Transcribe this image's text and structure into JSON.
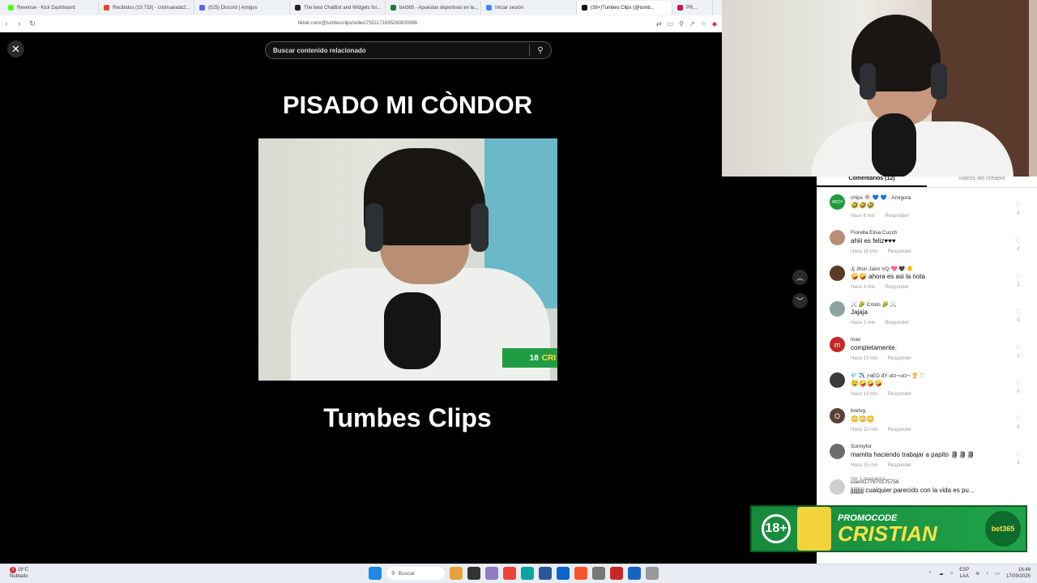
{
  "browser": {
    "tabs": [
      {
        "title": "Revenue - Kick Dashboard",
        "color": "#53fc18"
      },
      {
        "title": "Recibidos (19.733) - crishuarado2...",
        "color": "#ea4335"
      },
      {
        "title": "(525) Discord | Amigos",
        "color": "#5865f2"
      },
      {
        "title": "The best ChatBot and Widgets for...",
        "color": "#222222"
      },
      {
        "title": "bet365 - Apuestas deportivas en la...",
        "color": "#1f7a3d"
      },
      {
        "title": "Iniciar sesión",
        "color": "#4285f4"
      },
      {
        "title": "(39+)Tumbes Clips (@tumb...",
        "color": "#111111"
      },
      {
        "title": "PR...",
        "color": "#c2185b"
      }
    ],
    "url": "tiktok.com/@tumbesclips/video/7551171695260830998"
  },
  "video": {
    "close_icon": "✕",
    "search_placeholder": "Buscar contenido relacionado",
    "title": "PISADO MI CÒNDOR",
    "channel": "Tumbes Clips",
    "badge_text": "CRI",
    "badge_age": "18"
  },
  "comments": {
    "tab_comments": "Comentarios (12)",
    "tab_creator": "Videos del creador",
    "items": [
      {
        "user": "chips 🍭 💙 💙 · Amigo/a",
        "text": "🤣🤣🤣",
        "time": "Hace 6 min",
        "reply": "Responder",
        "likes": "0",
        "avatar": "MICH",
        "avatar_color": "#1e9b3c"
      },
      {
        "user": "Fiorella Elisa Cucch",
        "text": "ahiii es feliz♥♥♥",
        "time": "Hace 15 min",
        "reply": "Responder",
        "likes": "2",
        "avatar": "",
        "avatar_color": "#b88f74"
      },
      {
        "user": "Jj Jhon Jairo VQ 💖 🖤 🐥",
        "text": "🤪🤪 ahora es asi la nota",
        "time": "Hace 4 min",
        "reply": "Responder",
        "likes": "1",
        "avatar": "",
        "avatar_color": "#5a3a22"
      },
      {
        "user": "⚔️ 🌽 Cristo 🌽 ⚔️",
        "text": "Jajaja",
        "time": "Hace 2 min",
        "reply": "Responder",
        "likes": "0",
        "avatar": "",
        "avatar_color": "#8aa3a0"
      },
      {
        "user": "max",
        "text": "completamente.",
        "time": "Hace 13 min",
        "reply": "Responder",
        "likes": "1",
        "avatar": "m",
        "avatar_color": "#c62828"
      },
      {
        "user": "💎 ✈️ ƒяЕD đY αℓz¬‹σz¬ 🏆 ♡",
        "text": "🤤🤪🤪🤪",
        "time": "Hace 13 min",
        "reply": "Responder",
        "likes": "0",
        "avatar": "",
        "avatar_color": "#3b3b3b"
      },
      {
        "user": "bretvg",
        "text": "😳😳😳",
        "time": "Hace 15 min",
        "reply": "Responder",
        "likes": "0",
        "avatar": "O",
        "avatar_color": "#5d4037"
      },
      {
        "user": "Sunnyfor",
        "text": "mamita haciendo trabajar a papito 🗿🗿🗿",
        "time": "Hace 15 min",
        "reply": "Responder",
        "likes": "1",
        "avatar": "",
        "avatar_color": "#6d6d6d"
      },
      {
        "user": "user4177970175756",
        "text": "jjjjjjjjj cualquier parecido con la vida es pu...",
        "time": "",
        "reply": "",
        "likes": "",
        "avatar": "",
        "avatar_color": "#cfcfcf"
      }
    ],
    "more_replies": "Ver 1 respuesta ⌄"
  },
  "promo": {
    "age": "18+",
    "line1": "PROMOCODE",
    "line2": "CRISTIAN",
    "brand": "bet365"
  },
  "taskbar": {
    "weather_temp": "19°C",
    "weather_desc": "Nublado",
    "weather_badge": "2",
    "search": "Buscar",
    "lang1": "ESP",
    "lang2": "LAA",
    "time": "16:48",
    "date": "17/09/2025"
  },
  "colors": {
    "accent": "#1fa349",
    "brand_yellow": "#ffe14a"
  }
}
